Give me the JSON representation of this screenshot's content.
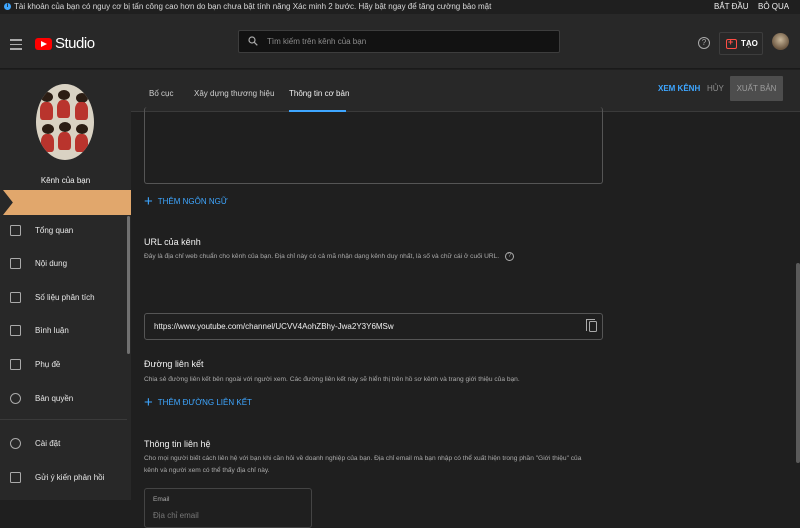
{
  "banner": {
    "message": "Tài khoản của bạn có nguy cơ bị tấn công cao hơn do bạn chưa bật tính năng Xác minh 2 bước. Hãy bật ngay để tăng cường bảo mật",
    "start_label": "BẮT ĐẦU",
    "skip_label": "BỎ QUA"
  },
  "header": {
    "logo_text": "Studio",
    "search_placeholder": "Tìm kiếm trên kênh của bạn",
    "create_label": "TẠO"
  },
  "sidebar": {
    "channel_label": "Kênh của bạn",
    "items": [
      {
        "label": "Tổng quan",
        "icon": "dashboard-icon"
      },
      {
        "label": "Nội dung",
        "icon": "content-icon"
      },
      {
        "label": "Số liệu phân tích",
        "icon": "analytics-icon"
      },
      {
        "label": "Bình luận",
        "icon": "comments-icon"
      },
      {
        "label": "Phụ đề",
        "icon": "subtitles-icon"
      },
      {
        "label": "Bản quyền",
        "icon": "copyright-icon"
      }
    ],
    "bottom_items": [
      {
        "label": "Cài đặt",
        "icon": "gear-icon"
      },
      {
        "label": "Gửi ý kiến phản hồi",
        "icon": "feedback-icon"
      }
    ]
  },
  "tabs": [
    {
      "label": "Bố cục",
      "active": false
    },
    {
      "label": "Xây dựng thương hiệu",
      "active": false
    },
    {
      "label": "Thông tin cơ bản",
      "active": true
    }
  ],
  "actions": {
    "view_channel": "XEM KÊNH",
    "cancel": "HỦY",
    "publish": "XUẤT BẢN"
  },
  "content": {
    "add_language": "THÊM NGÔN NGỮ",
    "url_section": {
      "title": "URL của kênh",
      "description": "Đây là địa chỉ web chuẩn cho kênh của bạn. Địa chỉ này có cả mã nhận dạng kênh duy nhất, là số và chữ cái ở cuối URL.",
      "value": "https://www.youtube.com/channel/UCVV4AohZBhy-Jwa2Y3Y6MSw"
    },
    "links_section": {
      "title": "Đường liên kết",
      "description": "Chia sẻ đường liên kết bên ngoài với người xem. Các đường liên kết này sẽ hiển thị trên hồ sơ kênh và trang giới thiệu của bạn.",
      "add_link": "THÊM ĐƯỜNG LIÊN KẾT"
    },
    "contact_section": {
      "title": "Thông tin liên hệ",
      "description_1": "Cho mọi người biết cách liên hệ với bạn khi cần hỏi về doanh nghiệp của bạn. Địa chỉ email mà bạn nhập có thể xuất hiện trong phần \"Giới thiệu\" của",
      "description_2": "kênh và người xem có thể thấy địa chỉ này.",
      "email_label": "Email",
      "email_placeholder": "Địa chỉ email"
    }
  },
  "colors": {
    "accent": "#3ea6ff",
    "brand_red": "#ff0000",
    "ribbon": "#e1a76c"
  }
}
